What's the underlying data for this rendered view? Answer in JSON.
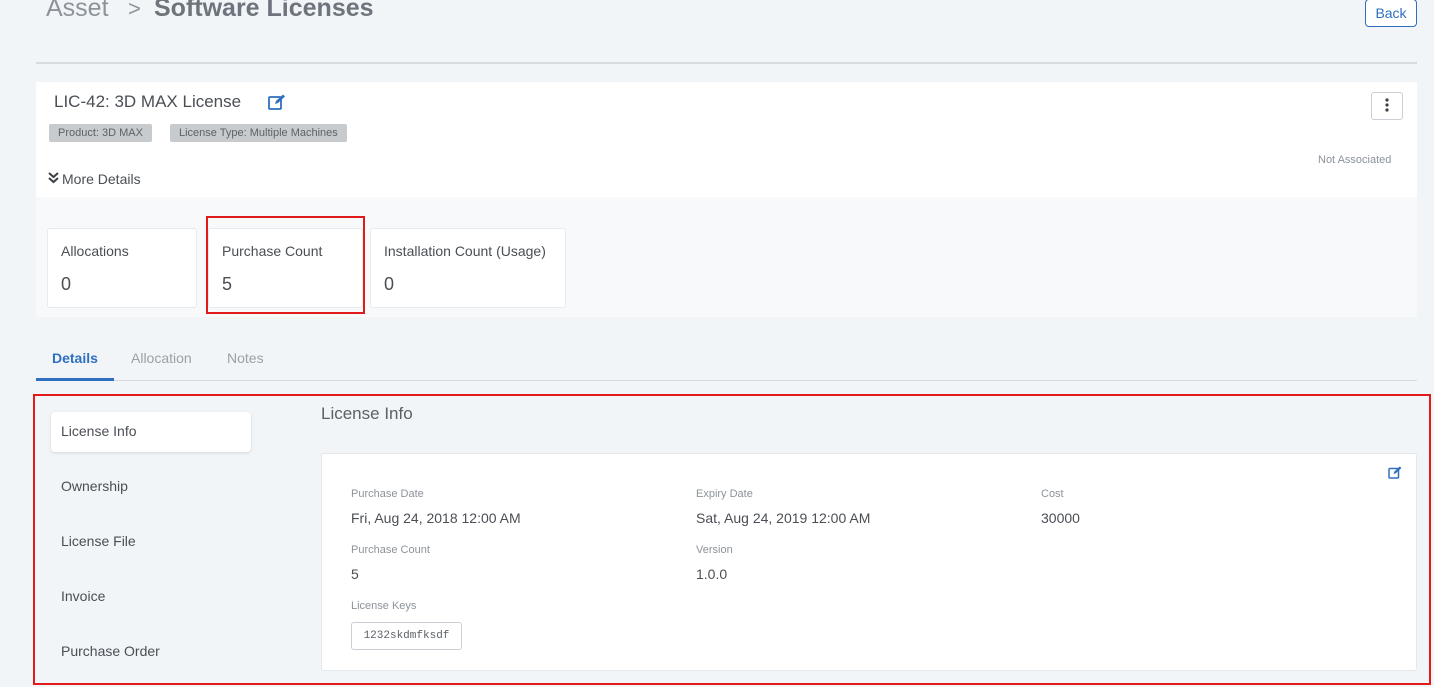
{
  "breadcrumb": {
    "root": "Asset",
    "separator": ">",
    "page": "Software Licenses"
  },
  "header": {
    "back_label": "Back"
  },
  "license": {
    "title": "LIC-42: 3D MAX License",
    "tags": [
      "Product: 3D MAX",
      "License Type: Multiple Machines"
    ],
    "association": "Not Associated",
    "more_details": "More Details"
  },
  "stats": [
    {
      "label": "Allocations",
      "value": "0"
    },
    {
      "label": "Purchase Count",
      "value": "5"
    },
    {
      "label": "Installation Count (Usage)",
      "value": "0"
    }
  ],
  "tabs": [
    {
      "label": "Details",
      "active": true
    },
    {
      "label": "Allocation",
      "active": false
    },
    {
      "label": "Notes",
      "active": false
    }
  ],
  "sidebar": {
    "items": [
      "License Info",
      "Ownership",
      "License File",
      "Invoice",
      "Purchase Order"
    ],
    "active": "License Info"
  },
  "license_info": {
    "title": "License Info",
    "fields": [
      {
        "label": "Purchase Date",
        "value": "Fri, Aug 24, 2018 12:00 AM"
      },
      {
        "label": "Expiry Date",
        "value": "Sat, Aug 24, 2019 12:00 AM"
      },
      {
        "label": "Cost",
        "value": "30000"
      },
      {
        "label": "Purchase Count",
        "value": "5"
      },
      {
        "label": "Version",
        "value": "1.0.0"
      },
      {
        "label": "License Keys",
        "value": "1232skdmfksdf"
      }
    ]
  },
  "colors": {
    "accent": "#2f6fbf",
    "highlight": "#e11a1a",
    "tag_bg": "#c8cbce"
  },
  "icons": {
    "edit": "edit-icon",
    "more": "vertical-dots-icon",
    "expand": "double-chevron-down-icon"
  }
}
